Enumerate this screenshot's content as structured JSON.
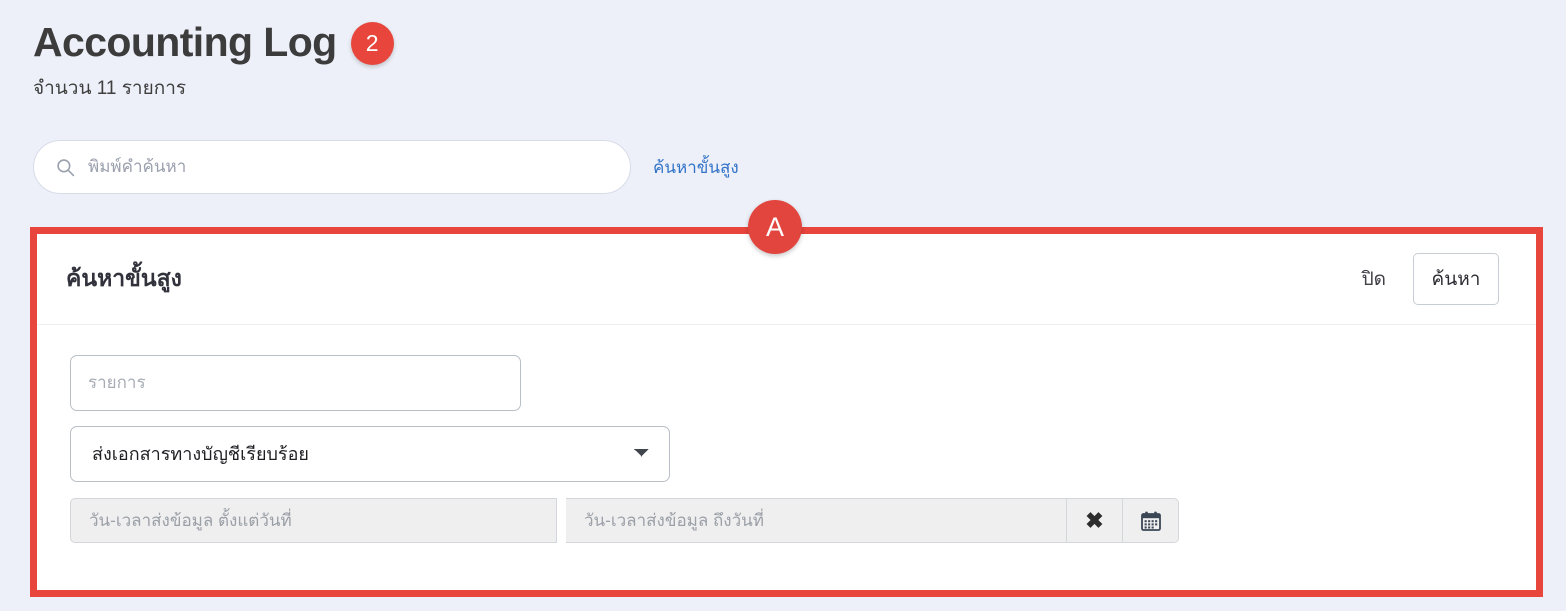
{
  "header": {
    "title": "Accounting Log",
    "count_badge": "2",
    "subtitle": "จำนวน 11 รายการ"
  },
  "search": {
    "placeholder": "พิมพ์คำค้นหา",
    "value": "",
    "icon": "search-icon",
    "advanced_link": "ค้นหาขั้นสูง"
  },
  "annotation": {
    "label": "A",
    "highlight_color": "#e8453c"
  },
  "advanced_panel": {
    "title": "ค้นหาขั้นสูง",
    "close_label": "ปิด",
    "search_button": "ค้นหา",
    "keyword_field": {
      "placeholder": "รายการ",
      "value": ""
    },
    "status_select": {
      "selected": "ส่งเอกสารทางบัญชีเรียบร้อย",
      "options": [
        "ส่งเอกสารทางบัญชีเรียบร้อย"
      ]
    },
    "date_from": {
      "placeholder": "วัน-เวลาส่งข้อมูล ตั้งแต่วันที่",
      "value": ""
    },
    "date_to": {
      "placeholder": "วัน-เวลาส่งข้อมูล ถึงวันที่",
      "value": ""
    },
    "clear_icon": "close-x-icon",
    "calendar_icon": "calendar-icon"
  },
  "colors": {
    "page_background": "#edf0f8",
    "accent_red": "#e8453c",
    "link_blue": "#3273c8"
  }
}
